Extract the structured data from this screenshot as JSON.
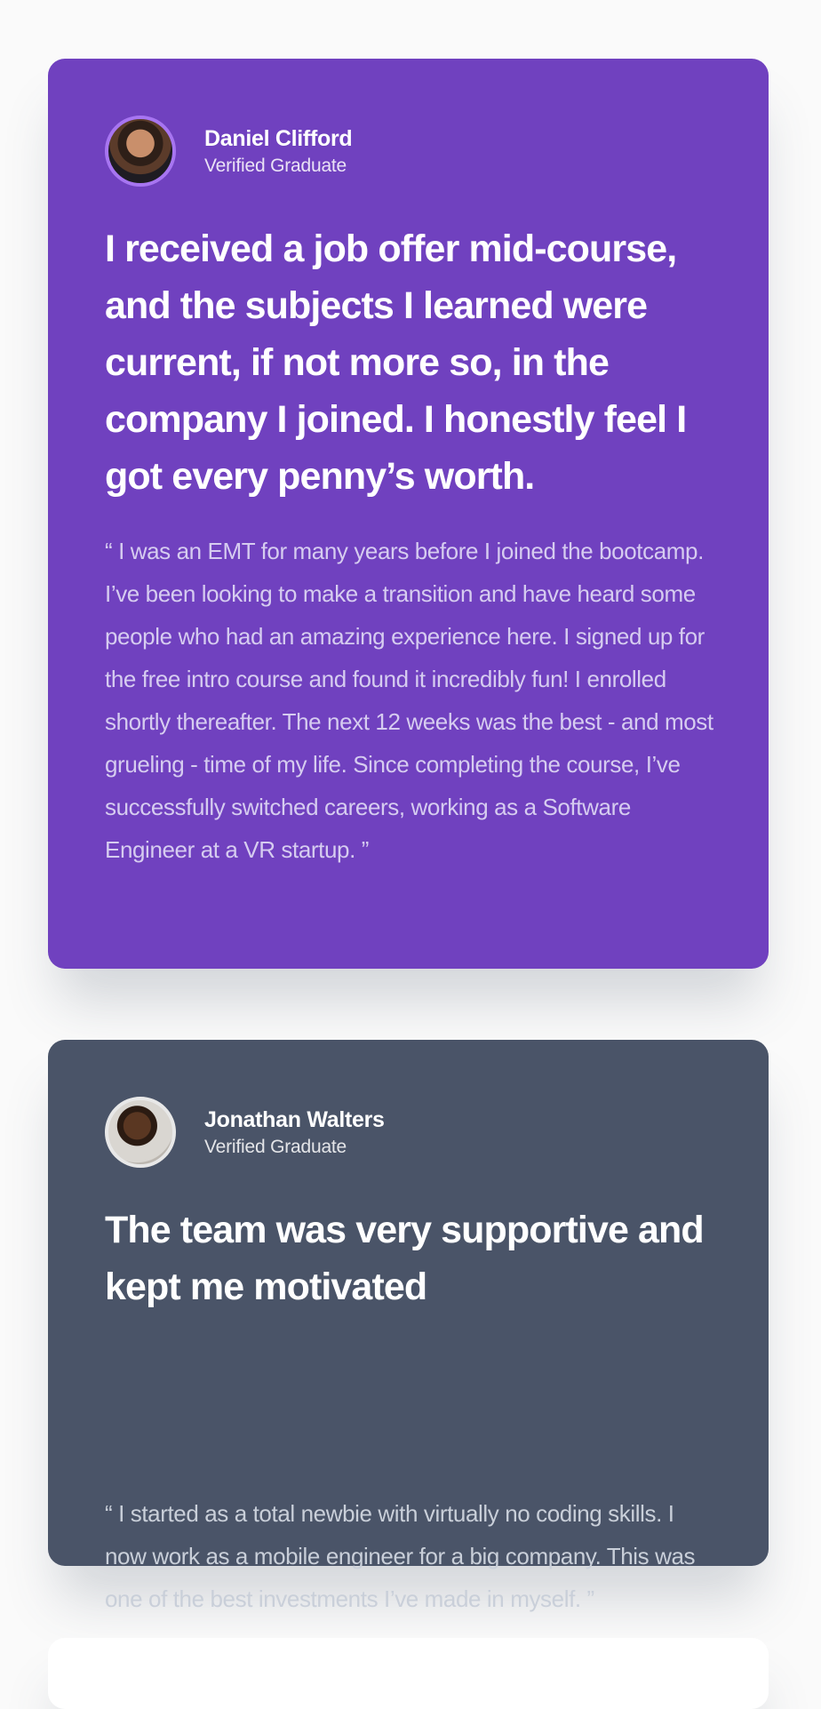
{
  "testimonials": [
    {
      "name": "Daniel Clifford",
      "badge": "Verified Graduate",
      "headline": "I received a job offer mid-course, and the subjects I learned were current, if not more so, in the company I joined. I honestly feel I got every penny’s worth.",
      "quote": "“ I was an EMT for many years before I joined the bootcamp. I’ve been looking to make a transition and have heard some people who had an amazing experience here. I signed up for the free intro course and found it incredibly fun! I enrolled shortly thereafter. The next 12 weeks was the best - and most grueling - time of my life. Since completing the course, I’ve successfully switched careers, working as a Software Engineer at a VR startup. ”",
      "card_color": "#7041bf"
    },
    {
      "name": "Jonathan Walters",
      "badge": "Verified Graduate",
      "headline": "The team was very supportive and kept me motivated",
      "quote": "“ I started as a total newbie with virtually no coding skills. I now work as a mobile engineer for a big company. This was one of the best investments I’ve made in myself. ”",
      "card_color": "#4a5468"
    }
  ],
  "icons": {
    "avatar_1": "avatar-photo",
    "avatar_2": "avatar-photo"
  }
}
